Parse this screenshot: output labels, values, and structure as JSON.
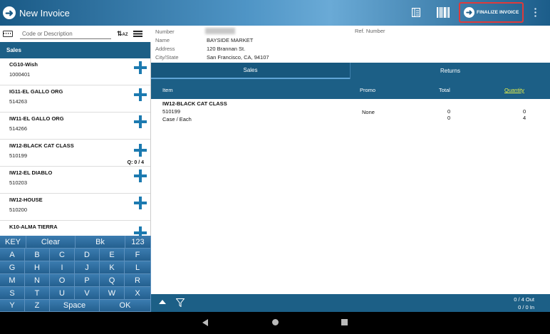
{
  "header": {
    "title": "New Invoice",
    "finalize_label": "FINALIZE INVOICE"
  },
  "search": {
    "placeholder": "Code or Description"
  },
  "left": {
    "section_label": "Sales",
    "products": [
      {
        "name": "CG10-Wish",
        "code": "1000401",
        "qty": ""
      },
      {
        "name": "IG11-EL GALLO ORG",
        "code": "514263",
        "qty": ""
      },
      {
        "name": "IW11-EL GALLO ORG",
        "code": "514266",
        "qty": ""
      },
      {
        "name": "IW12-BLACK CAT CLASS",
        "code": "510199",
        "qty": "Q: 0 / 4"
      },
      {
        "name": "IW12-EL DIABLO",
        "code": "510203",
        "qty": ""
      },
      {
        "name": "IW12-HOUSE",
        "code": "510200",
        "qty": ""
      },
      {
        "name": "K10-ALMA TIERRA",
        "code": "",
        "qty": ""
      }
    ]
  },
  "keyboard": {
    "row0": [
      "KEY",
      "Clear",
      "Bk",
      "123"
    ],
    "row1": [
      "A",
      "B",
      "C",
      "D",
      "E",
      "F"
    ],
    "row2": [
      "G",
      "H",
      "I",
      "J",
      "K",
      "L"
    ],
    "row3": [
      "M",
      "N",
      "O",
      "P",
      "Q",
      "R"
    ],
    "row4": [
      "S",
      "T",
      "U",
      "V",
      "W",
      "X"
    ],
    "row5": [
      "Y",
      "Z",
      "Space",
      "OK"
    ]
  },
  "customer": {
    "number_label": "Number",
    "name_label": "Name",
    "name_value": "BAYSIDE MARKET",
    "address_label": "Address",
    "address_value": "120 Brannan St.",
    "city_label": "City/State",
    "city_value": "San Francisco, CA, 94107",
    "ref_label": "Ref. Number"
  },
  "tabs": {
    "sales": "Sales",
    "returns": "Returns"
  },
  "table": {
    "headers": {
      "item": "Item",
      "promo": "Promo",
      "total": "Total",
      "quantity": "Quantity"
    },
    "rows": [
      {
        "name": "IW12-BLACK CAT CLASS",
        "code": "510199",
        "unit": "Case / Each",
        "promo": "None",
        "total_case": "0",
        "total_each": "0",
        "qty_case": "0",
        "qty_each": "4"
      }
    ]
  },
  "footer": {
    "out": "0 / 4 Out",
    "in": "0 / 0 In"
  },
  "colors": {
    "accent": "#1c5f86",
    "quantity_header": "#e6f04a",
    "finalize_border": "#e03a3a"
  }
}
